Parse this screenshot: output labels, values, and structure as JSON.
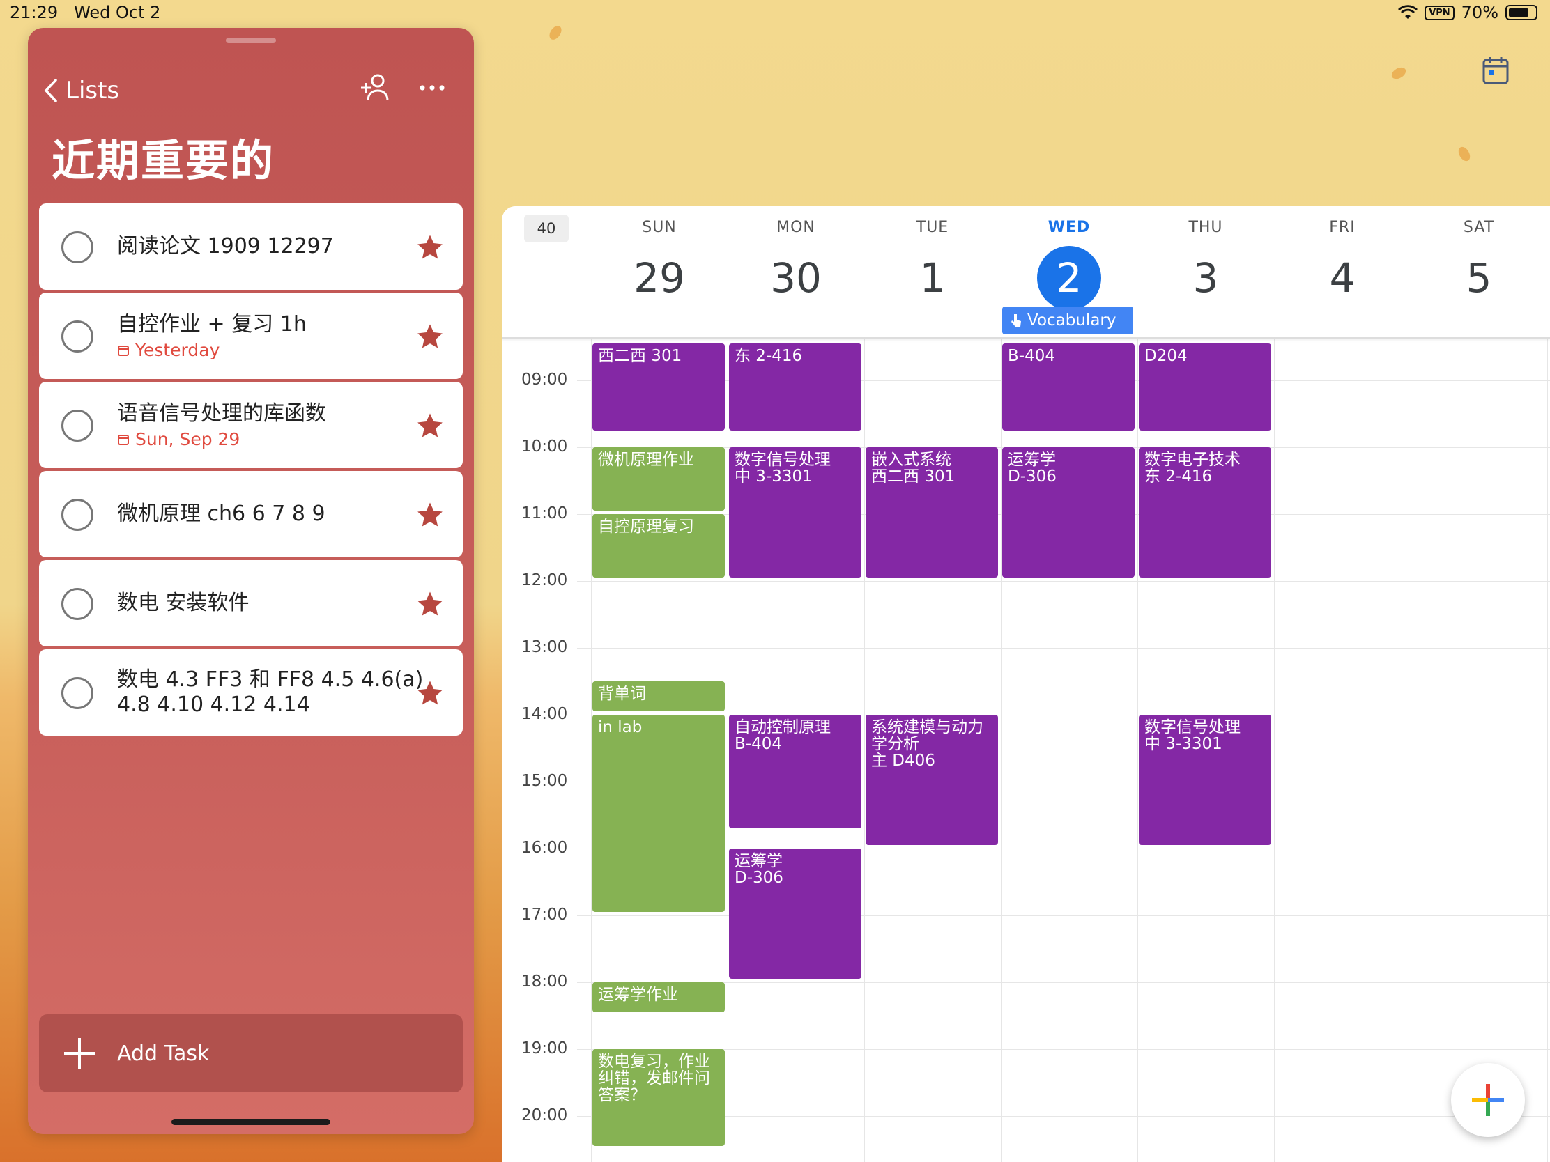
{
  "status": {
    "time": "21:29",
    "date": "Wed Oct 2",
    "vpn": "VPN",
    "battery": "70%"
  },
  "list_panel": {
    "back_label": "Lists",
    "title": "近期重要的",
    "tasks": [
      {
        "title": "阅读论文 1909 12297",
        "due": "",
        "starred": true
      },
      {
        "title": "自控作业 + 复习 1h",
        "due": "Yesterday",
        "starred": true
      },
      {
        "title": "语音信号处理的库函数",
        "due": "Sun, Sep 29",
        "starred": true
      },
      {
        "title": "微机原理 ch6 6 7 8 9",
        "due": "",
        "starred": true
      },
      {
        "title": "数电 安装软件",
        "due": "",
        "starred": true
      },
      {
        "title": "数电 4.3 FF3 和 FF8 4.5 4.6(a)",
        "title2": "4.8 4.10 4.12 4.14",
        "due": "",
        "starred": true
      }
    ],
    "add_task_label": "Add Task",
    "accent": "#c85f5b"
  },
  "calendar": {
    "week_number": "40",
    "days": [
      {
        "name": "SUN",
        "num": "29"
      },
      {
        "name": "MON",
        "num": "30"
      },
      {
        "name": "TUE",
        "num": "1"
      },
      {
        "name": "WED",
        "num": "2",
        "today": true
      },
      {
        "name": "THU",
        "num": "3"
      },
      {
        "name": "FRI",
        "num": "4"
      },
      {
        "name": "SAT",
        "num": "5"
      }
    ],
    "allday_event": "Vocabulary",
    "hours": [
      "09:00",
      "10:00",
      "11:00",
      "12:00",
      "13:00",
      "14:00",
      "15:00",
      "16:00",
      "17:00",
      "18:00",
      "19:00",
      "20:00"
    ],
    "events": [
      {
        "day": 0,
        "start": 8.45,
        "end": 9.75,
        "text": "西二西 301",
        "color": "purple"
      },
      {
        "day": 1,
        "start": 8.45,
        "end": 9.75,
        "text": "东 2-416",
        "color": "purple"
      },
      {
        "day": 3,
        "start": 8.45,
        "end": 9.75,
        "text": "B-404",
        "color": "purple"
      },
      {
        "day": 4,
        "start": 8.45,
        "end": 9.75,
        "text": "D204",
        "color": "purple"
      },
      {
        "day": 0,
        "start": 10.0,
        "end": 10.95,
        "text": "微机原理作业",
        "color": "green"
      },
      {
        "day": 0,
        "start": 11.0,
        "end": 11.95,
        "text": "自控原理复习",
        "color": "green"
      },
      {
        "day": 1,
        "start": 10.0,
        "end": 11.95,
        "text": "数字信号处理\n中 3-3301",
        "color": "purple"
      },
      {
        "day": 2,
        "start": 10.0,
        "end": 11.95,
        "text": "嵌入式系统\n西二西 301",
        "color": "purple"
      },
      {
        "day": 3,
        "start": 10.0,
        "end": 11.95,
        "text": "运筹学\nD-306",
        "color": "purple"
      },
      {
        "day": 4,
        "start": 10.0,
        "end": 11.95,
        "text": "数字电子技术\n东 2-416",
        "color": "purple"
      },
      {
        "day": 0,
        "start": 13.5,
        "end": 13.95,
        "text": "背单词",
        "color": "green"
      },
      {
        "day": 0,
        "start": 14.0,
        "end": 16.95,
        "text": "in lab",
        "color": "green"
      },
      {
        "day": 1,
        "start": 14.0,
        "end": 15.7,
        "text": "自动控制原理\nB-404",
        "color": "purple"
      },
      {
        "day": 2,
        "start": 14.0,
        "end": 15.95,
        "text": "系统建模与动力学分析\n主 D406",
        "color": "purple"
      },
      {
        "day": 4,
        "start": 14.0,
        "end": 15.95,
        "text": "数字信号处理\n中 3-3301",
        "color": "purple"
      },
      {
        "day": 1,
        "start": 16.0,
        "end": 17.95,
        "text": "运筹学\nD-306",
        "color": "purple"
      },
      {
        "day": 0,
        "start": 18.0,
        "end": 18.45,
        "text": "运筹学作业",
        "color": "green"
      },
      {
        "day": 0,
        "start": 19.0,
        "end": 20.45,
        "text": "数电复习，作业纠错，发邮件问答案？",
        "color": "green"
      }
    ],
    "colors": {
      "purple": "#8428a5",
      "green": "#86b253",
      "today": "#1a73e8"
    }
  }
}
